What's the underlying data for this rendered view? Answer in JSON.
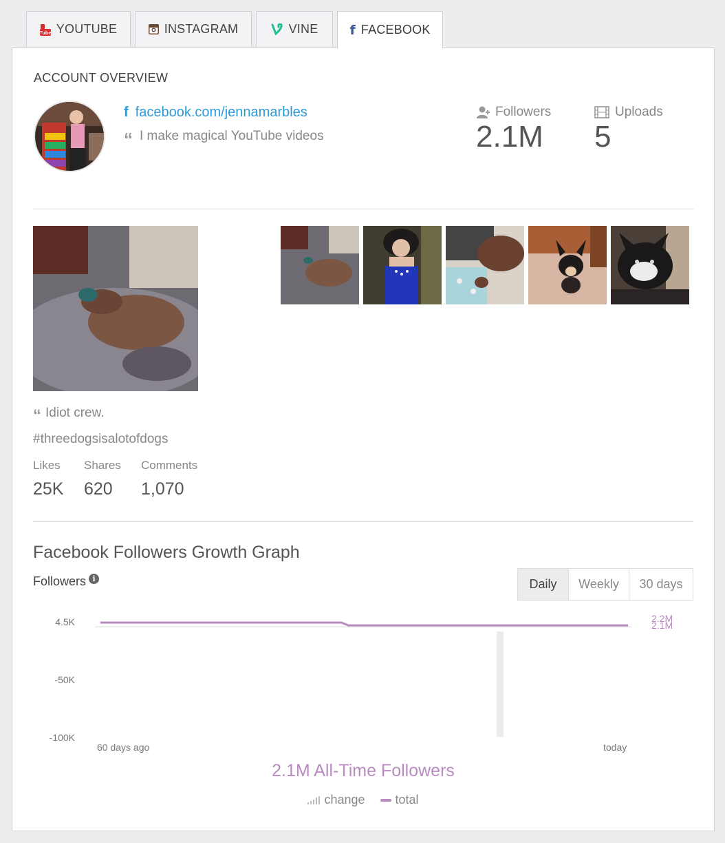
{
  "tabs": [
    {
      "label": "YOUTUBE",
      "icon": "youtube-icon"
    },
    {
      "label": "INSTAGRAM",
      "icon": "instagram-icon"
    },
    {
      "label": "VINE",
      "icon": "vine-icon"
    },
    {
      "label": "FACEBOOK",
      "icon": "facebook-icon",
      "active": true
    }
  ],
  "overview": {
    "title": "ACCOUNT OVERVIEW",
    "link": "facebook.com/jennamarbles",
    "bio": "I make magical YouTube videos",
    "followers_label": "Followers",
    "followers_value": "2.1M",
    "uploads_label": "Uploads",
    "uploads_value": "5"
  },
  "post": {
    "caption_line1": "Idiot crew.",
    "caption_line2": "#threedogsisalotofdogs",
    "likes_label": "Likes",
    "likes_value": "25K",
    "shares_label": "Shares",
    "shares_value": "620",
    "comments_label": "Comments",
    "comments_value": "1,070"
  },
  "graph": {
    "title": "Facebook Followers Growth Graph",
    "metric_label": "Followers",
    "ranges": [
      "Daily",
      "Weekly",
      "30 days"
    ],
    "selected_range": "Daily",
    "all_time": "2.1M All-Time Followers",
    "legend_change": "change",
    "legend_total": "total",
    "accent": "#b98bc1"
  },
  "chart_data": {
    "type": "line",
    "yticks": [
      "4.5K",
      "-50K",
      "-100K"
    ],
    "ylim": [
      -100000,
      4500
    ],
    "x_start_label": "60 days ago",
    "x_end_label": "today",
    "right_labels": [
      "2.2M",
      "2.1M"
    ],
    "series": [
      {
        "name": "change",
        "type": "bar",
        "values": [
          0,
          0,
          -100000
        ]
      },
      {
        "name": "total",
        "type": "line",
        "values": [
          2200000,
          2200000,
          2100000,
          2100000
        ]
      }
    ]
  }
}
